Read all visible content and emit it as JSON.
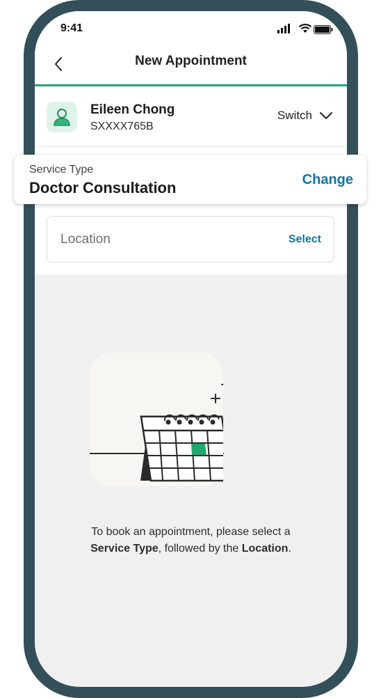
{
  "status_bar": {
    "time": "9:41",
    "icons": [
      "signal-icon",
      "wifi-icon",
      "battery-icon"
    ]
  },
  "nav": {
    "title": "New Appointment",
    "back_icon": "chevron-left-icon"
  },
  "profile": {
    "name": "Eileen Chong",
    "id": "SXXXX765B",
    "switch_label": "Switch",
    "avatar_icon": "person-icon"
  },
  "service_type": {
    "label": "Service Type",
    "value": "Doctor Consultation",
    "action": "Change"
  },
  "location": {
    "placeholder": "Location",
    "action": "Select"
  },
  "empty_state": {
    "icon": "calendar-illustration",
    "message_part1": "To book an appointment, please select a",
    "message_bold1": "Service Type",
    "message_part2": ", followed by the ",
    "message_bold2": "Location",
    "message_part3": "."
  },
  "colors": {
    "accent_green": "#21a67a",
    "link_blue": "#0f74a8",
    "frame": "#33505a",
    "background": "#f0f0f0"
  }
}
